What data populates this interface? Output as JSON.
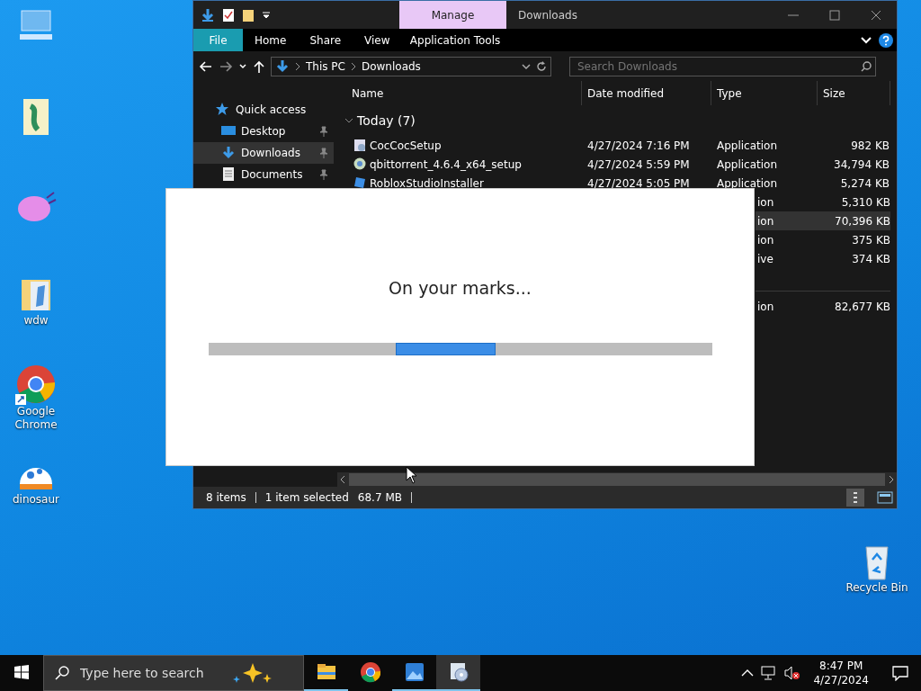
{
  "desktop_icons": [
    {
      "kind": "pc"
    },
    {
      "kind": "doc"
    },
    {
      "kind": "blob"
    },
    {
      "kind": "folder",
      "label": "wdw"
    },
    {
      "kind": "chrome",
      "label": "Google Chrome"
    },
    {
      "kind": "dino",
      "label": "dinosaur"
    }
  ],
  "recycle_bin": {
    "label": "Recycle Bin"
  },
  "explorer": {
    "title": "Downloads",
    "context_tab": "Manage",
    "ribbon_tabs": [
      {
        "label": "File",
        "kind": "file"
      },
      {
        "label": "Home",
        "kind": "tab"
      },
      {
        "label": "Share",
        "kind": "tab"
      },
      {
        "label": "View",
        "kind": "tab"
      },
      {
        "label": "Application Tools",
        "kind": "context"
      }
    ],
    "breadcrumb": [
      "This PC",
      "Downloads"
    ],
    "search": {
      "placeholder": "Search Downloads"
    },
    "nav_items": [
      {
        "label": "Quick access",
        "kind": "star",
        "selected": false,
        "pinned": false
      },
      {
        "label": "Desktop",
        "kind": "desktop",
        "selected": false,
        "pinned": true
      },
      {
        "label": "Downloads",
        "kind": "download",
        "selected": true,
        "pinned": true
      },
      {
        "label": "Documents",
        "kind": "document",
        "selected": false,
        "pinned": true
      }
    ],
    "columns": [
      "Name",
      "Date modified",
      "Type",
      "Size"
    ],
    "group": "Today (7)",
    "rows": [
      {
        "kind": "coccoc",
        "name": "CocCocSetup",
        "date": "4/27/2024 7:16 PM",
        "type": "Application",
        "size": "982 KB",
        "selected": false
      },
      {
        "kind": "qbit",
        "name": "qbittorrent_4.6.4_x64_setup",
        "date": "4/27/2024 5:59 PM",
        "type": "Application",
        "size": "34,794 KB",
        "selected": false
      },
      {
        "kind": "roblox",
        "name": "RobloxStudioInstaller",
        "date": "4/27/2024 5:05 PM",
        "type": "Application",
        "size": "5,274 KB",
        "selected": false
      },
      {
        "kind": "covered",
        "type": "ion",
        "size": "5,310 KB",
        "selected": false
      },
      {
        "kind": "covered",
        "type": "ion",
        "size": "70,396 KB",
        "selected": true
      },
      {
        "kind": "covered",
        "type": "ion",
        "size": "375 KB",
        "selected": false
      },
      {
        "kind": "covered",
        "type": "ive",
        "size": "374 KB",
        "selected": false
      },
      {
        "kind": "group"
      },
      {
        "kind": "covered",
        "type": "ion",
        "size": "82,677 KB",
        "selected": false
      }
    ],
    "status": {
      "count": "8 items",
      "selection": "1 item selected",
      "size": "68.7 MB"
    }
  },
  "dialog": {
    "message": "On your marks...",
    "progress": {
      "kind": "marquee"
    }
  },
  "taskbar": {
    "search_placeholder": "Type here to search",
    "apps": [
      {
        "kind": "explorer",
        "running": true,
        "selected": false
      },
      {
        "kind": "chrome",
        "running": false,
        "selected": false
      },
      {
        "kind": "photos",
        "running": true,
        "selected": false
      },
      {
        "kind": "installer",
        "running": true,
        "selected": true
      }
    ],
    "time": "8:47 PM",
    "date": "4/27/2024"
  }
}
